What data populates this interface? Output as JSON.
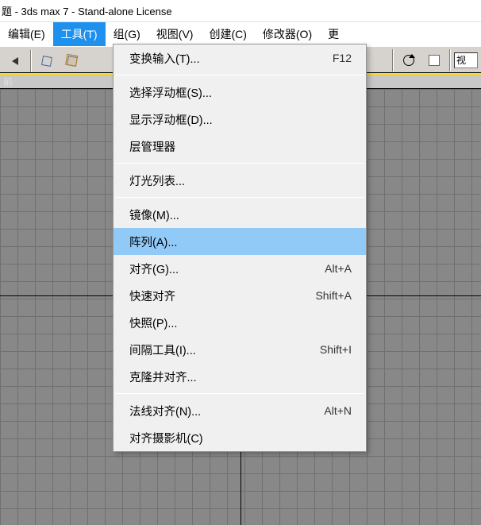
{
  "title_bar": "题 - 3ds max 7  - Stand-alone License",
  "menubar": {
    "edit": "编辑(E)",
    "tools": "工具(T)",
    "group": "组(G)",
    "view": "视图(V)",
    "create": "创建(C)",
    "modifiers": "修改器(O)",
    "more": "更"
  },
  "toolbar_right_text": "视",
  "viewport_label": "前",
  "tools_menu": {
    "transform_type_in": {
      "label": "变换输入(T)...",
      "shortcut": "F12"
    },
    "selection_floater": {
      "label": "选择浮动框(S)..."
    },
    "display_floater": {
      "label": "显示浮动框(D)..."
    },
    "layer_manager": {
      "label": "层管理器"
    },
    "light_lister": {
      "label": "灯光列表..."
    },
    "mirror": {
      "label": "镜像(M)..."
    },
    "array": {
      "label": "阵列(A)..."
    },
    "align": {
      "label": "对齐(G)...",
      "shortcut": "Alt+A"
    },
    "quick_align": {
      "label": "快速对齐",
      "shortcut": "Shift+A"
    },
    "snapshot": {
      "label": "快照(P)..."
    },
    "spacing_tool": {
      "label": "间隔工具(I)...",
      "shortcut": "Shift+I"
    },
    "clone_and_align": {
      "label": "克隆并对齐..."
    },
    "normal_align": {
      "label": "法线对齐(N)...",
      "shortcut": "Alt+N"
    },
    "align_camera": {
      "label": "对齐摄影机(C)"
    }
  }
}
